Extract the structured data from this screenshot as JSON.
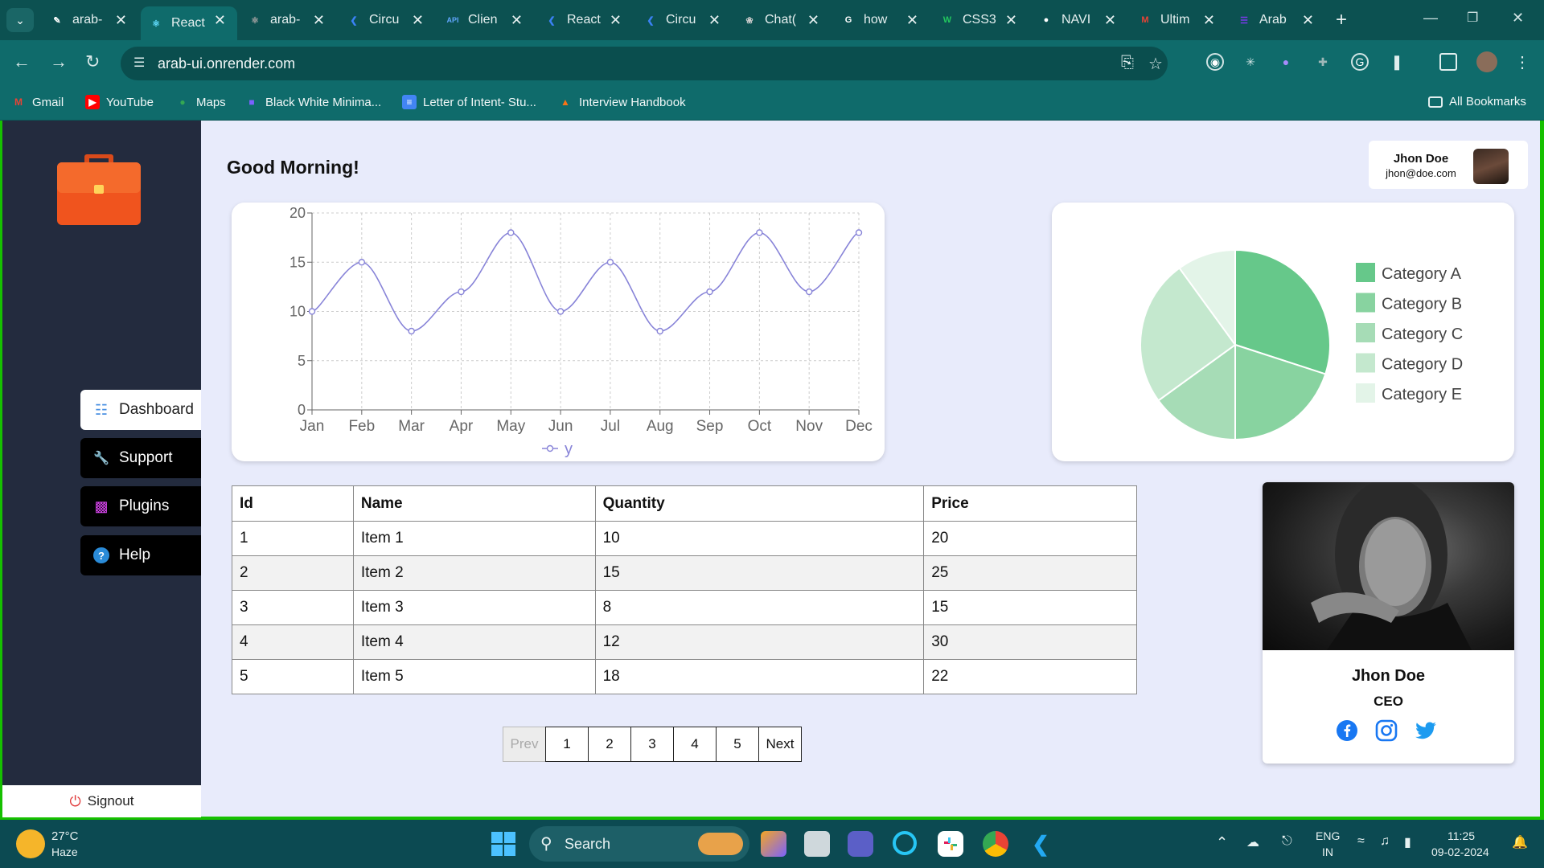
{
  "browser": {
    "tabs": [
      {
        "label": "arab-",
        "icon": "pen-icon",
        "color": "#ffffff"
      },
      {
        "label": "React",
        "icon": "react-icon",
        "color": "#61dafb",
        "active": true
      },
      {
        "label": "arab-",
        "icon": "react-icon",
        "color": "#a0a0a0"
      },
      {
        "label": "Circu",
        "icon": "vscode-icon",
        "color": "#3b82f6"
      },
      {
        "label": "Clien",
        "icon": "api-icon",
        "color": "#60a5fa"
      },
      {
        "label": "React",
        "icon": "vscode-icon",
        "color": "#3b82f6"
      },
      {
        "label": "Circu",
        "icon": "vscode-icon",
        "color": "#3b82f6"
      },
      {
        "label": "Chat(",
        "icon": "chatgpt-icon",
        "color": "#cccccc"
      },
      {
        "label": "how",
        "icon": "google-icon",
        "color": "#ffffff"
      },
      {
        "label": "CSS3",
        "icon": "w3-icon",
        "color": "#22c55e"
      },
      {
        "label": "NAVI",
        "icon": "github-icon",
        "color": "#ffffff"
      },
      {
        "label": "Ultim",
        "icon": "gmail-icon",
        "color": "#ea4335"
      },
      {
        "label": "Arab",
        "icon": "form-icon",
        "color": "#7c3aed"
      }
    ],
    "api_badge": "API",
    "url": "arab-ui.onrender.com",
    "bookmarks": [
      {
        "label": "Gmail",
        "icon": "gmail-icon"
      },
      {
        "label": "YouTube",
        "icon": "youtube-icon"
      },
      {
        "label": "Maps",
        "icon": "maps-icon"
      },
      {
        "label": "Black White Minima...",
        "icon": "canva-icon"
      },
      {
        "label": "Letter of Intent- Stu...",
        "icon": "docs-icon"
      },
      {
        "label": "Interview Handbook",
        "icon": "cone-icon"
      }
    ],
    "all_bookmarks": "All Bookmarks"
  },
  "sidebar": {
    "nav": [
      {
        "label": "Dashboard",
        "icon": "grid-icon",
        "active": true
      },
      {
        "label": "Support",
        "icon": "wrench-icon"
      },
      {
        "label": "Plugins",
        "icon": "puzzle-icon"
      },
      {
        "label": "Help",
        "icon": "question-icon"
      }
    ],
    "signout": "Signout"
  },
  "main": {
    "greeting": "Good Morning!",
    "user": {
      "name": "Jhon Doe",
      "email": "jhon@doe.com"
    }
  },
  "chart_data": [
    {
      "type": "line",
      "categories": [
        "Jan",
        "Feb",
        "Mar",
        "Apr",
        "May",
        "Jun",
        "Jul",
        "Aug",
        "Sep",
        "Oct",
        "Nov",
        "Dec"
      ],
      "series": [
        {
          "name": "y",
          "values": [
            10,
            15,
            8,
            12,
            18,
            10,
            15,
            8,
            12,
            18,
            12,
            18
          ],
          "color": "#8884d8"
        }
      ],
      "ylim": [
        0,
        20
      ],
      "yticks": [
        0,
        5,
        10,
        15,
        20
      ],
      "grid": "dashed",
      "legend": "bottom"
    },
    {
      "type": "pie",
      "categories": [
        "Category A",
        "Category B",
        "Category C",
        "Category D",
        "Category E"
      ],
      "values": [
        30,
        20,
        15,
        25,
        10
      ],
      "colors": [
        "#66c88a",
        "#88d3a0",
        "#a6dcb6",
        "#c4e8ce",
        "#e3f4e8"
      ],
      "legend": "right"
    }
  ],
  "table": {
    "headers": [
      "Id",
      "Name",
      "Quantity",
      "Price"
    ],
    "rows": [
      [
        "1",
        "Item 1",
        "10",
        "20"
      ],
      [
        "2",
        "Item 2",
        "15",
        "25"
      ],
      [
        "3",
        "Item 3",
        "8",
        "15"
      ],
      [
        "4",
        "Item 4",
        "12",
        "30"
      ],
      [
        "5",
        "Item 5",
        "18",
        "22"
      ]
    ]
  },
  "pagination": {
    "prev": "Prev",
    "pages": [
      "1",
      "2",
      "3",
      "4",
      "5"
    ],
    "next": "Next"
  },
  "profile": {
    "name": "Jhon Doe",
    "role": "CEO",
    "social": [
      "facebook-icon",
      "instagram-icon",
      "twitter-icon"
    ]
  },
  "taskbar": {
    "weather": {
      "temp": "27°C",
      "condition": "Haze"
    },
    "search": "Search",
    "lang1": "ENG",
    "lang2": "IN",
    "time": "11:25",
    "date": "09-02-2024"
  }
}
